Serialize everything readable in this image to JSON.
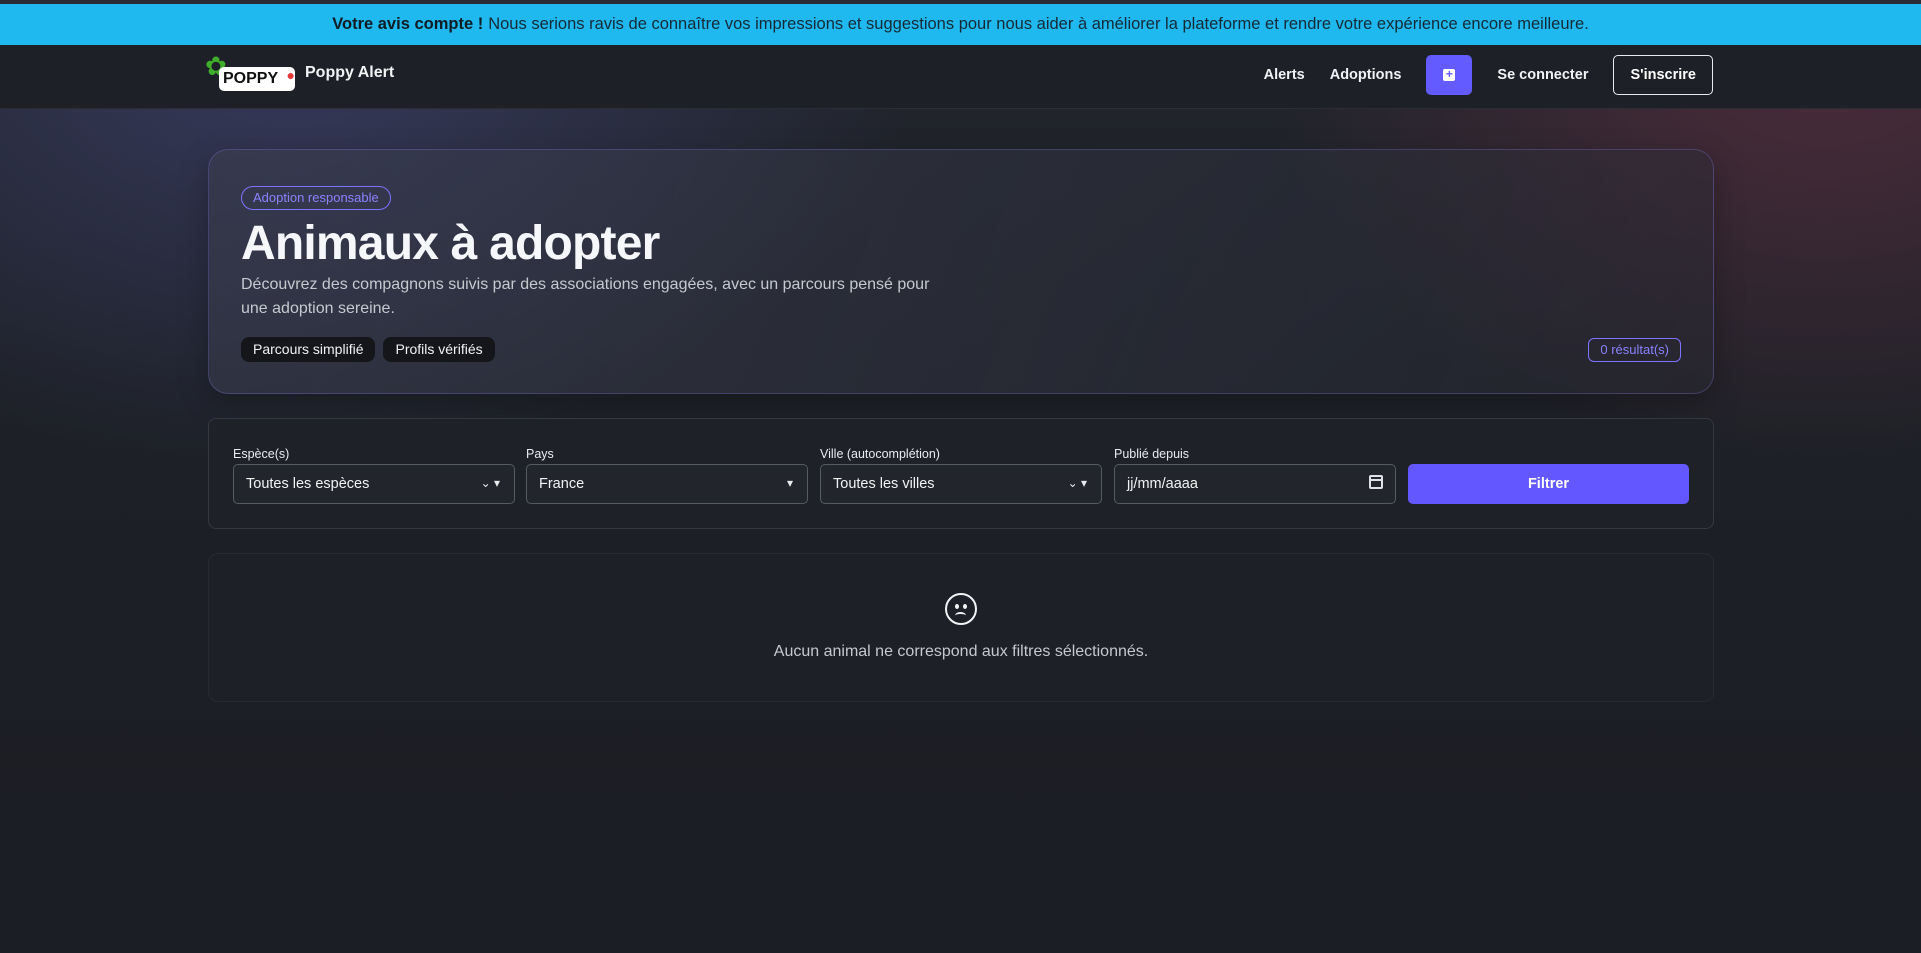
{
  "banner": {
    "bold": "Votre avis compte !",
    "text": "Nous serions ravis de connaître vos impressions et suggestions pour nous aider à améliorer la plateforme et rendre votre expérience encore meilleure."
  },
  "navbar": {
    "logo_text": "POPPY",
    "brand_name": "Poppy Alert",
    "links": [
      "Alerts",
      "Adoptions"
    ],
    "add_icon": "plus-square-icon",
    "login": "Se connecter",
    "signup": "S'inscrire"
  },
  "hero": {
    "badge": "Adoption responsable",
    "title": "Animaux à adopter",
    "lead": "Découvrez des compagnons suivis par des associations engagées, avec un parcours pensé pour une adoption sereine.",
    "chips": [
      "Parcours simplifié",
      "Profils vérifiés"
    ],
    "results": "0 résultat(s)"
  },
  "filters": {
    "species": {
      "label": "Espèce(s)",
      "value": "Toutes les espèces"
    },
    "country": {
      "label": "Pays",
      "value": "France"
    },
    "city": {
      "label": "Ville (autocomplétion)",
      "value": "Toutes les villes"
    },
    "published": {
      "label": "Publié depuis",
      "placeholder": "jj/mm/aaaa"
    },
    "submit": "Filtrer"
  },
  "empty_state": {
    "icon": "sad-face-icon",
    "message": "Aucun animal ne correspond aux filtres sélectionnés."
  },
  "colors": {
    "banner": "#1fb8ef",
    "accent": "#635bff",
    "background": "#1b1e24"
  }
}
